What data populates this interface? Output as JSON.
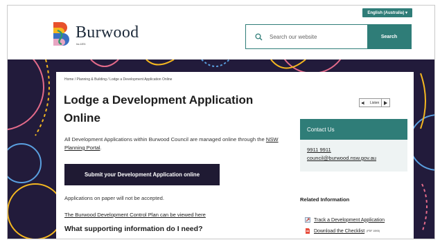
{
  "language": {
    "label": "English (Australia) ▾"
  },
  "header": {
    "brand": "Burwood",
    "brand_sub": "Inc.1874",
    "search": {
      "placeholder": "Search our website",
      "button": "Search"
    }
  },
  "breadcrumb": [
    "Home",
    "/",
    "Planning & Building",
    "/",
    "Lodge a Development Application Online"
  ],
  "main": {
    "title": "Lodge a Development Application Online",
    "intro_text": "All Development Applications within Burwood Council are managed online through the",
    "intro_link": "NSW Planning Portal",
    "intro_end": ".",
    "cta": "Submit your Development Application online",
    "paper_note": "Applications on paper will not be accepted.",
    "dcp_link": "The Burwood Development Control Plan can be viewed here",
    "section_heading": "What supporting information do I need?"
  },
  "listen": {
    "label": "Listen"
  },
  "contact": {
    "heading": "Contact Us",
    "phone": "9911 9911",
    "email": "council@burwood.nsw.gov.au"
  },
  "related": {
    "heading": "Related Information",
    "items": [
      {
        "label": "Track a Development Application"
      },
      {
        "label": "Download the Checklist",
        "suffix": "(PDF 10KB)"
      }
    ]
  },
  "colors": {
    "teal": "#2f7d78",
    "navy": "#221b3b",
    "button": "#1f1a33"
  }
}
